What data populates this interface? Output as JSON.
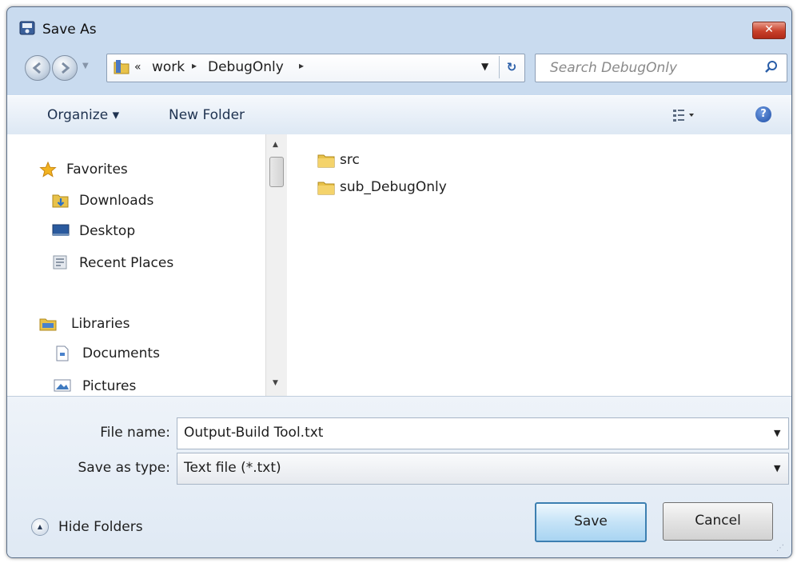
{
  "window": {
    "title": "Save As",
    "close_glyph": "✕"
  },
  "address": {
    "overflow": "«",
    "crumbs": [
      "work",
      "DebugOnly"
    ],
    "separator": "▸",
    "refresh_glyph": "↻"
  },
  "search": {
    "placeholder": "Search DebugOnly"
  },
  "toolbar": {
    "organize": "Organize ▾",
    "new_folder": "New Folder",
    "help_glyph": "?"
  },
  "navpane": {
    "favorites": {
      "label": "Favorites",
      "items": [
        "Downloads",
        "Desktop",
        "Recent Places"
      ]
    },
    "libraries": {
      "label": "Libraries",
      "items": [
        "Documents",
        "Pictures"
      ]
    }
  },
  "files": [
    {
      "name": "src",
      "icon": "folder-icon"
    },
    {
      "name": "sub_DebugOnly",
      "icon": "folder-icon"
    }
  ],
  "form": {
    "file_name_label": "File name:",
    "file_name_value": "Output-Build Tool.txt",
    "type_label": "Save as type:",
    "type_value": "Text file (*.txt)"
  },
  "footer": {
    "hide_folders": "Hide Folders",
    "save": "Save",
    "cancel": "Cancel"
  },
  "colors": {
    "chrome": "#c9dbef",
    "close_red": "#c8402a",
    "accent_blue": "#3c7fb1",
    "folder_yellow": "#e8c24a"
  }
}
